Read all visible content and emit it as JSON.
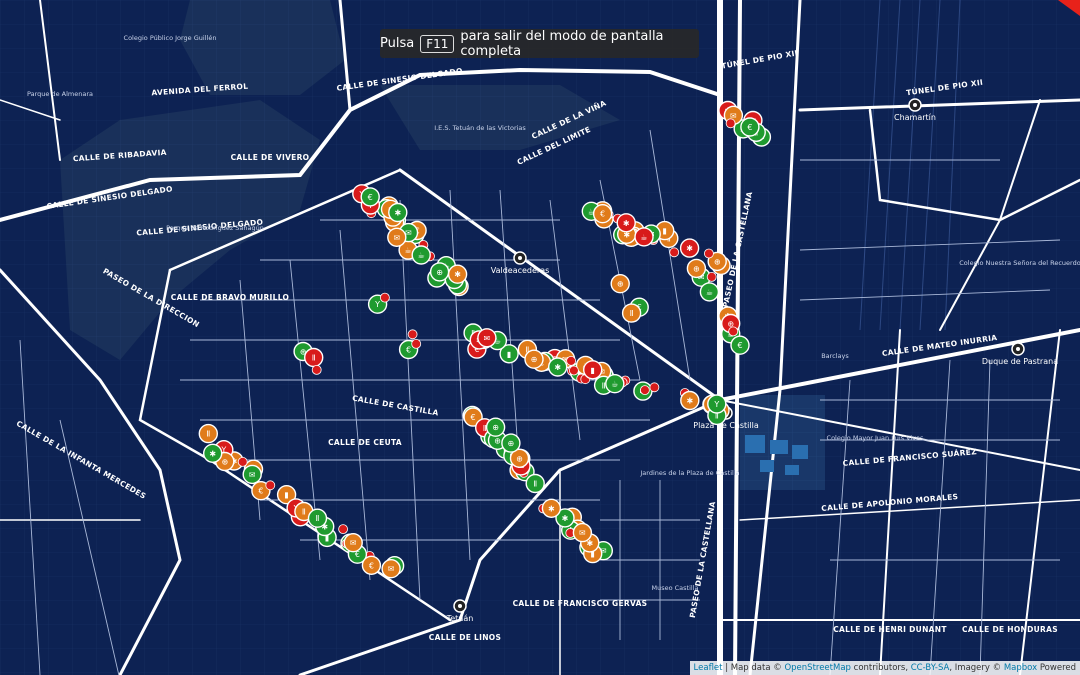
{
  "fullscreen_notice": {
    "prefix": "Pulsa",
    "key": "F11",
    "suffix": "para salir del modo de pantalla completa"
  },
  "attribution": {
    "leaflet": "Leaflet",
    "map_data": "| Map data ©",
    "osm": "OpenStreetMap",
    "contributors": "contributors,",
    "license": "CC-BY-SA",
    "imagery": ", Imagery ©",
    "mapbox": "Mapbox",
    "powered": "Powered"
  },
  "streets": [
    "CALLE DE SINESIO DELGADO",
    "CALLE DE SINESIO DELGADO",
    "CALLE DE SINESIO DELGADO",
    "AVENIDA DEL FERROL",
    "CALLE DE RIBADAVIA",
    "CALLE DE VIVERO",
    "PASEO DE LA DIRECCION",
    "CALLE DE LA VIÑA",
    "PASEO DE LA CASTELLANA",
    "PASEO DE LA CASTELLANA",
    "CALLE DE MATEO INURRIA",
    "CALLE DE FRANCISCO GERVAS",
    "CALLE DE HENRI DUNANT",
    "CALLE DE HONDURAS",
    "CALLE DEL LIMITE",
    "TÚNEL DE PIO XII",
    "TÚNEL DE PIO XII",
    "CALLE DE APOLONIO MORALES",
    "CALLE DE FRANCISCO SUÁREZ",
    "CALLE DE CASTILLA",
    "CALLE DE CEUTA",
    "CALLE DE LA INFANTA MERCEDES",
    "CALLE DE BRAVO MURILLO",
    "CALLE DE LINOS"
  ],
  "pois": [
    "Colegio Público Jorge Guillén",
    "Parque de Rodríguez Sahagún",
    "I.E.S. Tetuán de las Victorias",
    "Colegio Mayor Juan Luis Vives",
    "Jardines de la Plaza de Castilla",
    "Museo Castilla",
    "Colegio Nuestra Señora del Recuerdo",
    "Barclays",
    "Parque de Almenara"
  ],
  "stations": [
    "Chamartín",
    "Plaza de Castilla",
    "Duque de Pastrana",
    "Valdeacederas",
    "Tetuán"
  ],
  "colors": {
    "water_bg": "#0b1f4d",
    "block": "#132c63",
    "park": "#22375a",
    "road": "#ffffff",
    "marker_green": "#1f9a2f",
    "marker_orange": "#e07b1a",
    "marker_red": "#d81b1b"
  },
  "markers_legend_note": "",
  "icons": [
    "station-icon",
    "restaurant-icon",
    "cafe-icon",
    "bar-icon",
    "pharmacy-icon",
    "shop-icon",
    "atm-icon"
  ]
}
